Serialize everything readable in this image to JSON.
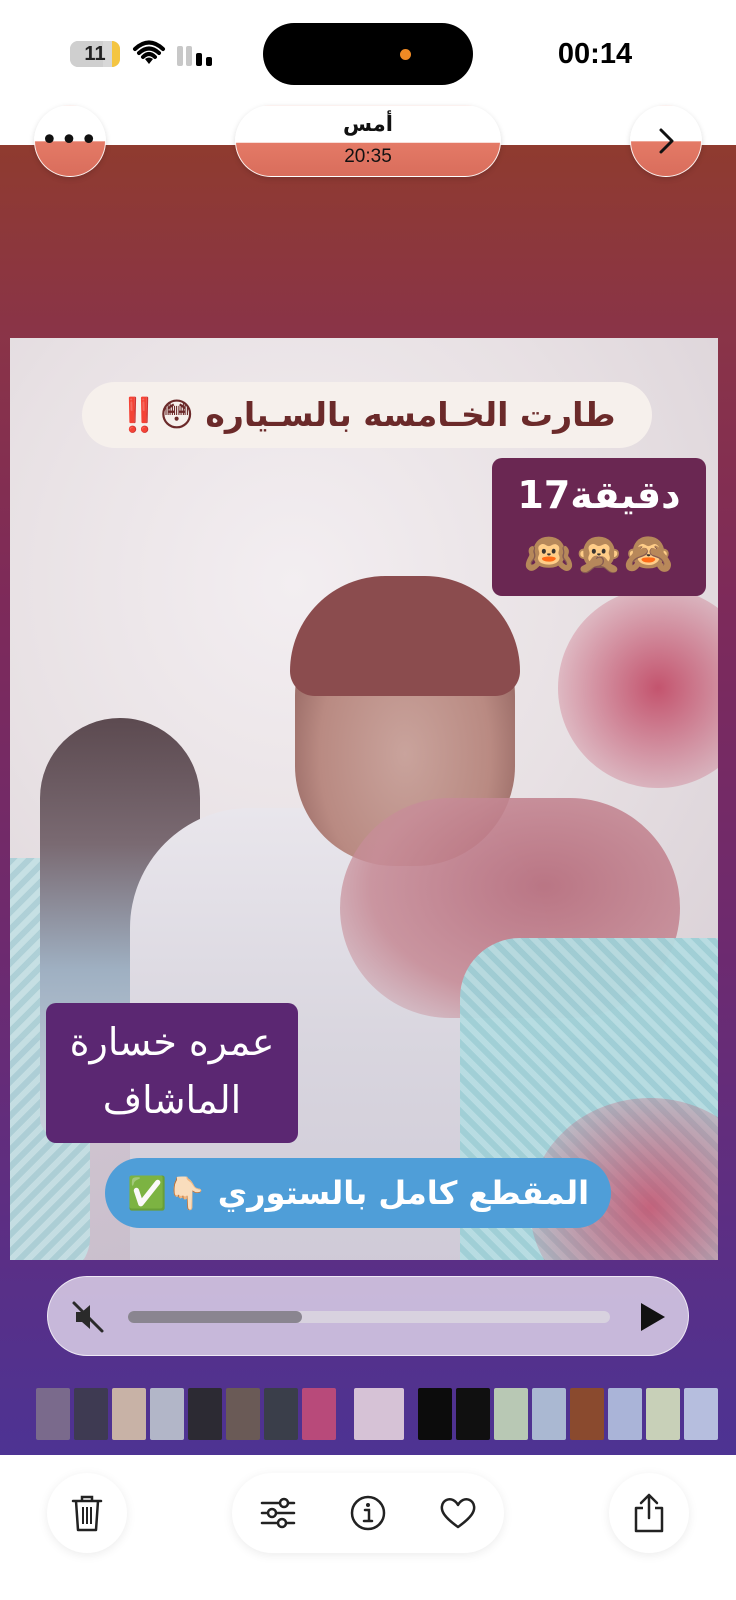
{
  "status_bar": {
    "time": "00:14",
    "battery_level": "11",
    "icons": [
      "wifi-icon",
      "cellular-signal-icon"
    ]
  },
  "header": {
    "date_label": "أمس",
    "time_label": "20:35",
    "more_icon": "ellipsis-icon",
    "next_icon": "chevron-right-icon"
  },
  "media": {
    "caption_top": "طارت الخـامسه بالسـياره 😳‼️",
    "caption_minutes_line1": "17دقيقة",
    "caption_minutes_line2": "🙉🙊🙈",
    "caption_name_line1": "عمره خسارة",
    "caption_name_line2": "الماشاف",
    "caption_story": "المقطع كامل بالستوري 👇🏻✅"
  },
  "player": {
    "mute_icon": "speaker-muted-icon",
    "play_icon": "play-icon",
    "progress": 0.36
  },
  "thumbnails": {
    "selected_index": 8,
    "colors": [
      "#7a6a8c",
      "#3e3a52",
      "#c8b2a6",
      "#b2b6c8",
      "#2c2a33",
      "#6a5a56",
      "#3a3e4a",
      "#b84a7a",
      "#d6c2d6",
      "#0c0c0c",
      "#101010",
      "#b8c8b4",
      "#aab8d2",
      "#8a4a2e",
      "#aab4d8",
      "#c8d0b8",
      "#b6bede"
    ]
  },
  "toolbar": {
    "delete_icon": "trash-icon",
    "adjust_icon": "sliders-icon",
    "info_icon": "info-icon",
    "favorite_icon": "heart-icon",
    "share_icon": "share-icon"
  }
}
